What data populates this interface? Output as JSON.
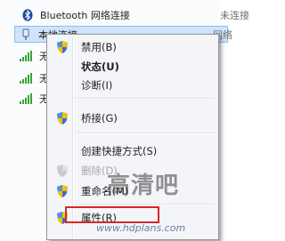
{
  "connections": [
    {
      "name": "Bluetooth 网络连接",
      "status": "未连接",
      "icon": "bluetooth-icon"
    },
    {
      "name": "本地连接",
      "status": "网络",
      "icon": "network-adapter-icon"
    },
    {
      "name": "无",
      "icon": "wireless-signal-icon"
    },
    {
      "name": "无",
      "icon": "wireless-signal-icon"
    },
    {
      "name": "无",
      "icon": "wireless-signal-icon"
    }
  ],
  "context_menu": {
    "items": [
      {
        "label": "禁用(B)",
        "icon": "shield-icon"
      },
      {
        "label": "状态(U)"
      },
      {
        "label": "诊断(I)"
      },
      {
        "label": "桥接(G)",
        "icon": "shield-icon"
      },
      {
        "label": "创建快捷方式(S)"
      },
      {
        "label": "删除(D)",
        "icon": "shield-icon"
      },
      {
        "label": "重命名(M)",
        "icon": "shield-icon"
      },
      {
        "label": "属性(R)",
        "icon": "shield-icon"
      }
    ]
  },
  "watermark": {
    "logo": "高清吧",
    "url": "www.hdplans.com"
  },
  "colors": {
    "selection": "#cfe4fb",
    "highlight_box": "#d6262b"
  }
}
